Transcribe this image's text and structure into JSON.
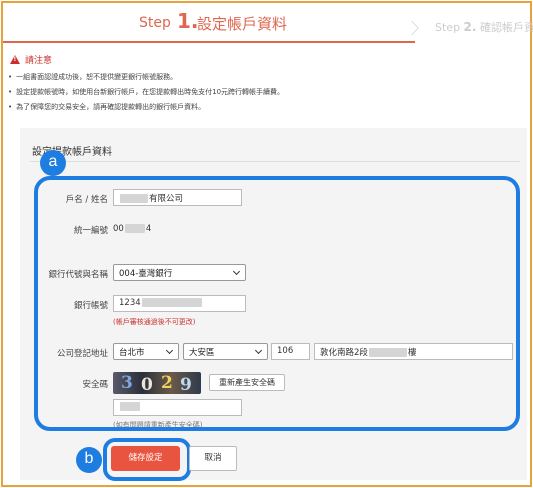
{
  "steps": {
    "current": {
      "label": "Step",
      "number": "1.",
      "title": "設定帳戶資料"
    },
    "next": {
      "label": "Step",
      "number": "2.",
      "title": "確認帳戶資"
    }
  },
  "notice": {
    "title": "請注意",
    "items": [
      "一組書面認證成功後，恕不提供變更銀行帳號服務。",
      "設定提款帳號時，如使用台新銀行帳戶，在您提款轉出時免支付10元跨行轉帳手續費。",
      "為了保障您的交易安全，請再確認提款轉出的銀行帳戶資料。"
    ]
  },
  "form": {
    "section_title": "設定提款帳戶資料",
    "name_label": "戶名 / 姓名",
    "name_value": "有限公司",
    "tax_label": "統一編號",
    "tax_prefix": "00",
    "tax_suffix": "4",
    "bank_label": "銀行代號與名稱",
    "bank_value": "004-臺灣銀行",
    "account_label": "銀行帳號",
    "account_prefix": "1234",
    "account_hint": "(帳戶審核通過後不可更改)",
    "address_label": "公司登記地址",
    "city_value": "台北市",
    "district_value": "大安區",
    "zip_value": "106",
    "street_prefix": "敦化南路2段",
    "street_suffix": "樓",
    "captcha_label": "安全碼",
    "captcha_chars": [
      "3",
      "0",
      "2",
      "9"
    ],
    "refresh_label": "重新產生安全碼",
    "captcha_hint": "(如有問題請重新產生安全碼)"
  },
  "annotations": {
    "a": "a",
    "b": "b"
  },
  "actions": {
    "save_label": "儲存設定",
    "cancel_label": "取消"
  },
  "colors": {
    "accent": "#e0664e",
    "callout": "#1e7de0",
    "warning": "#c9302c",
    "save": "#e8543f"
  }
}
